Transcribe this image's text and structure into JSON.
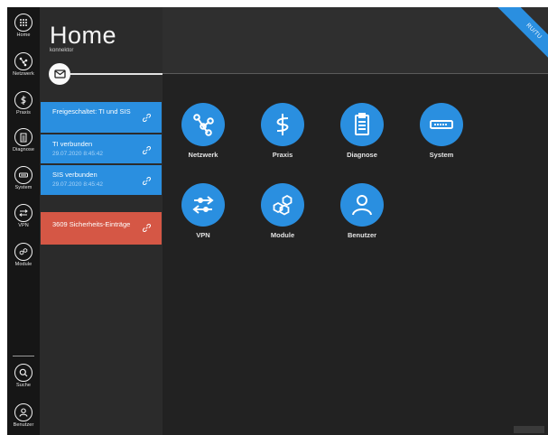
{
  "rail": {
    "items": [
      {
        "label": "Home",
        "icon": "grid-icon"
      },
      {
        "label": "Netzwerk",
        "icon": "network-icon"
      },
      {
        "label": "Praxis",
        "icon": "caduceus-icon"
      },
      {
        "label": "Diagnose",
        "icon": "clipboard-icon"
      },
      {
        "label": "System",
        "icon": "server-icon"
      },
      {
        "label": "VPN",
        "icon": "vpn-icon"
      },
      {
        "label": "Module",
        "icon": "hexagons-icon"
      }
    ],
    "bottom": [
      {
        "label": "Suche",
        "icon": "search-icon"
      },
      {
        "label": "Benutzer",
        "icon": "user-icon"
      }
    ]
  },
  "panel": {
    "title": "Home",
    "subtitle": "konnektor",
    "cards": [
      {
        "title": "Freigeschaltet: TI und SIS",
        "sub": "",
        "color": "blue"
      },
      {
        "title": "TI verbunden",
        "sub": "29.07.2020 8:45:42",
        "color": "blue"
      },
      {
        "title": "SIS verbunden",
        "sub": "29.07.2020 8:45:42",
        "color": "blue"
      },
      {
        "title": "3609 Sicherheits-Einträge",
        "sub": "",
        "color": "red"
      }
    ]
  },
  "main": {
    "ribbon": "RU/TU",
    "tiles": [
      {
        "label": "Netzwerk",
        "icon": "network-icon"
      },
      {
        "label": "Praxis",
        "icon": "caduceus-icon"
      },
      {
        "label": "Diagnose",
        "icon": "clipboard-icon"
      },
      {
        "label": "System",
        "icon": "server-icon"
      },
      {
        "label": "VPN",
        "icon": "vpn-icon"
      },
      {
        "label": "Module",
        "icon": "hexagons-icon"
      },
      {
        "label": "Benutzer",
        "icon": "user-icon"
      }
    ]
  },
  "colors": {
    "accent": "#2a8fe0",
    "alert": "#d55745",
    "rail": "#161616",
    "panel": "#2b2b2b",
    "main": "#222222"
  }
}
